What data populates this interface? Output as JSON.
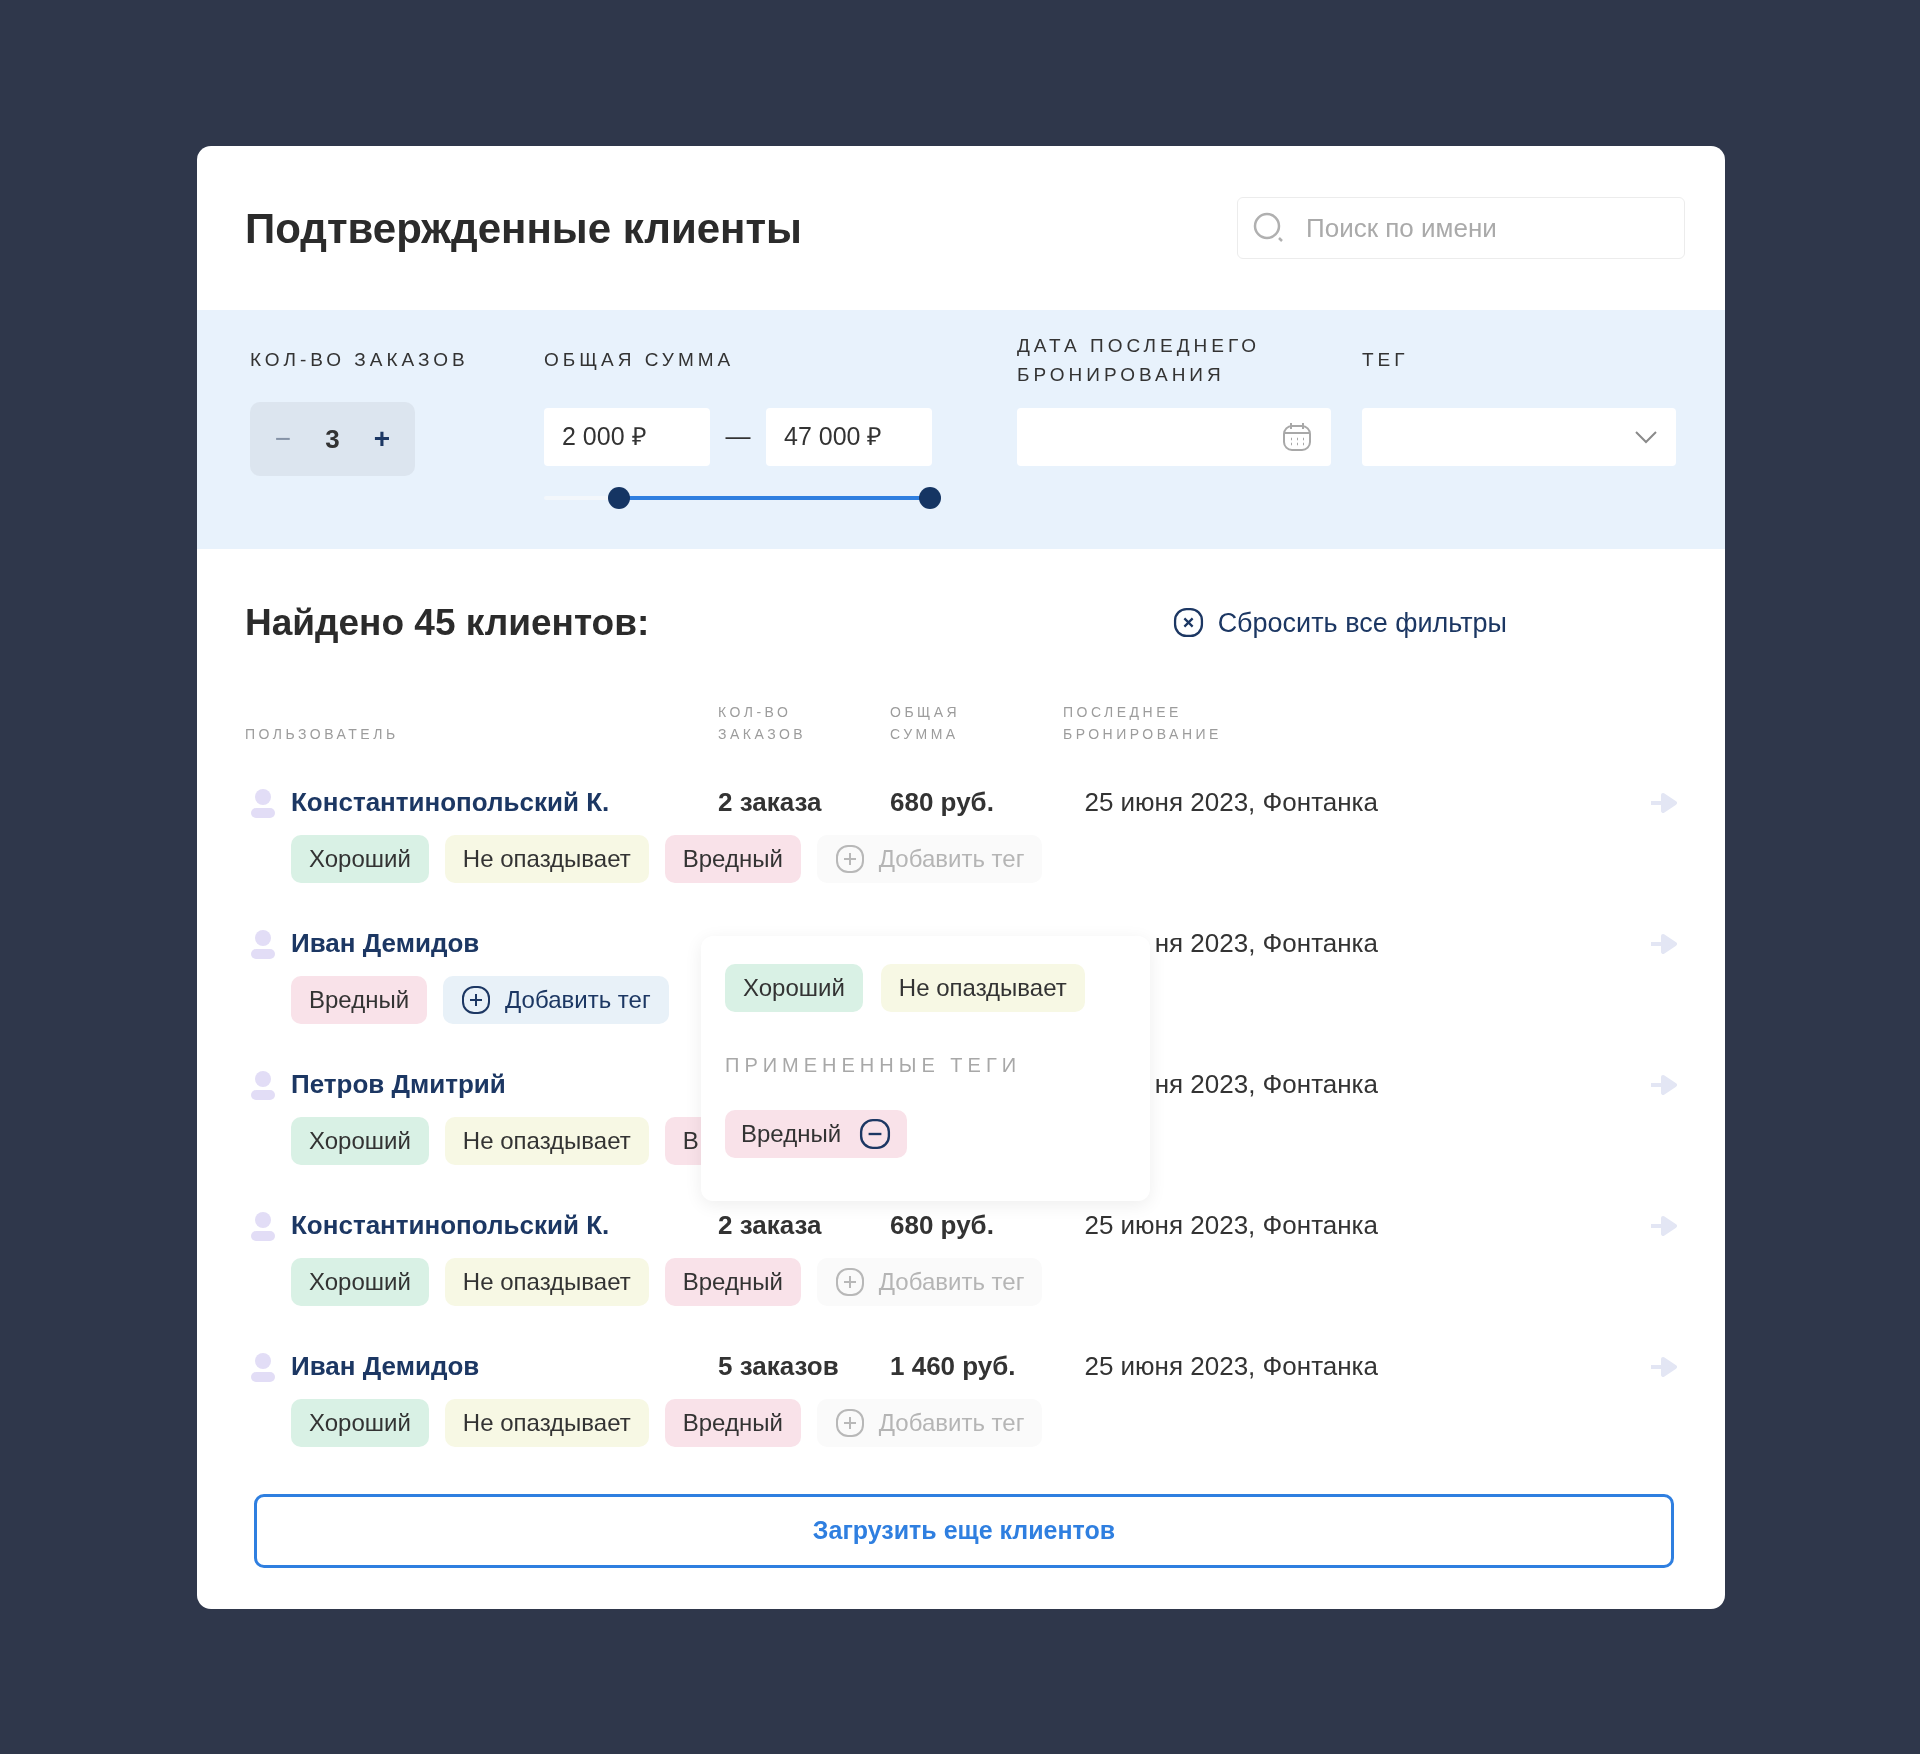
{
  "header": {
    "title": "Подтвержденные клиенты",
    "search": {
      "placeholder": "Поиск по имени"
    }
  },
  "filters": {
    "orders": {
      "label": "КОЛ-ВО ЗАКАЗОВ",
      "minus": "−",
      "value": "3",
      "plus": "+"
    },
    "sum": {
      "label": "ОБЩАЯ СУММА",
      "from": "2 000 ₽",
      "dash": "—",
      "to": "47 000 ₽",
      "thumbs": [
        {
          "level": 0.19
        },
        {
          "level": 0.98
        }
      ]
    },
    "date": {
      "label": "ДАТА ПОСЛЕДНЕГО БРОНИРОВАНИЯ"
    },
    "tag": {
      "label": "ТЕГ"
    }
  },
  "results": {
    "title": "Найдено 45 клиентов:",
    "reset": "Сбросить все фильтры"
  },
  "columns": [
    "ПОЛЬЗОВАТЕЛЬ",
    "КОЛ-ВО ЗАКАЗОВ",
    "ОБЩАЯ СУММА",
    "ПОСЛЕДНЕЕ БРОНИРОВАНИЕ"
  ],
  "rows": [
    {
      "name": "Константинопольский К.",
      "orders": "2 заказа",
      "sum": "680 руб.",
      "date": "25 июня 2023, Фонтанка",
      "tags": [
        {
          "kind": "tag",
          "label": "Хороший",
          "color": "#d9f1e5"
        },
        {
          "kind": "tag",
          "label": "Не опаздывает",
          "color": "#f7f8e4"
        },
        {
          "kind": "tag",
          "label": "Вредный",
          "color": "#f9e2e9"
        },
        {
          "kind": "add",
          "label": "Добавить тег",
          "active": false
        }
      ]
    },
    {
      "name": "Иван Демидов",
      "date": "ня 2023, Фонтанка",
      "tags": [
        {
          "kind": "tag",
          "label": "Вредный",
          "color": "#f9e2e9"
        },
        {
          "kind": "add",
          "label": "Добавить тег",
          "active": true
        }
      ]
    },
    {
      "name": "Петров Дмитрий",
      "date": "ня 2023, Фонтанка",
      "tags": [
        {
          "kind": "tag",
          "label": "Хороший",
          "color": "#d9f1e5"
        },
        {
          "kind": "tag",
          "label": "Не опаздывает",
          "color": "#f7f8e4"
        },
        {
          "kind": "tag",
          "label": "В",
          "color": "#f9e2e9"
        }
      ]
    },
    {
      "name": "Константинопольский К.",
      "orders": "2 заказа",
      "sum": "680 руб.",
      "date": "25 июня 2023, Фонтанка",
      "tags": [
        {
          "kind": "tag",
          "label": "Хороший",
          "color": "#d9f1e5"
        },
        {
          "kind": "tag",
          "label": "Не опаздывает",
          "color": "#f7f8e4"
        },
        {
          "kind": "tag",
          "label": "Вредный",
          "color": "#f9e2e9"
        },
        {
          "kind": "add",
          "label": "Добавить тег",
          "active": false
        }
      ]
    },
    {
      "name": "Иван Демидов",
      "orders": "5 заказов",
      "sum": "1 460 руб.",
      "date": "25 июня 2023, Фонтанка",
      "tags": [
        {
          "kind": "tag",
          "label": "Хороший",
          "color": "#d9f1e5"
        },
        {
          "kind": "tag",
          "label": "Не опаздывает",
          "color": "#f7f8e4"
        },
        {
          "kind": "tag",
          "label": "Вредный",
          "color": "#f9e2e9"
        },
        {
          "kind": "add",
          "label": "Добавить тег",
          "active": false
        }
      ]
    }
  ],
  "popup": {
    "available": [
      {
        "label": "Хороший",
        "color": "#d9f1e5"
      },
      {
        "label": "Не опаздывает",
        "color": "#f7f8e4"
      }
    ],
    "applied_title": "ПРИМЕНЕННЫЕ ТЕГИ",
    "applied": [
      {
        "label": "Вредный",
        "color": "#f9e2e9"
      }
    ]
  },
  "load_more": "Загрузить еще клиентов"
}
